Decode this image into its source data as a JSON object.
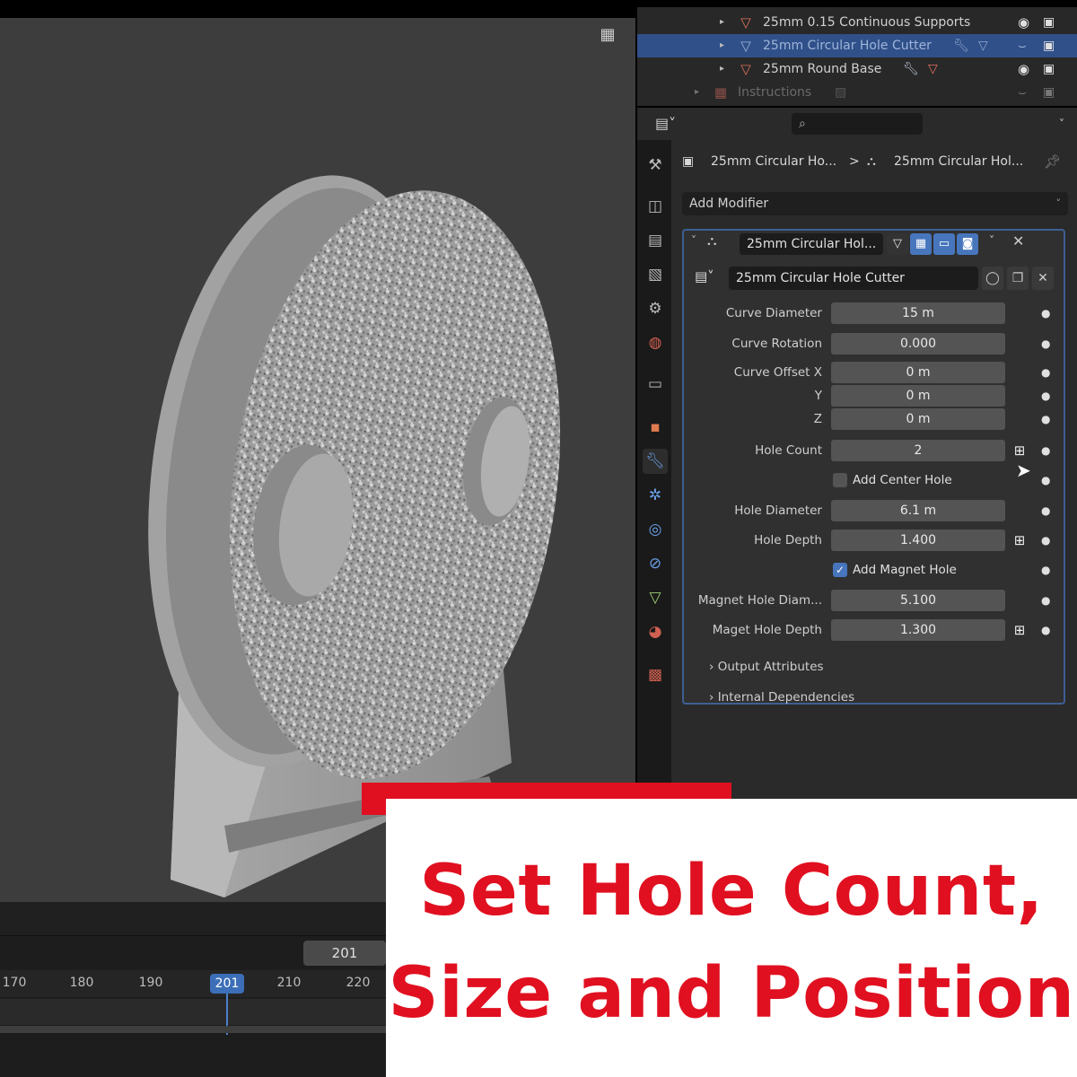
{
  "outliner": {
    "rows": [
      {
        "label": "25mm 0.15 Continuous Supports"
      },
      {
        "label": "25mm Circular Hole Cutter"
      },
      {
        "label": "25mm Round Base"
      },
      {
        "label": "Instructions"
      }
    ]
  },
  "properties": {
    "breadcrumb": {
      "object": "25mm Circular Ho...",
      "separator": ">",
      "modifier": "25mm Circular Hol..."
    },
    "add_modifier_label": "Add Modifier",
    "modifier": {
      "name": "25mm Circular Hol...",
      "node_group": "25mm Circular Hole Cutter",
      "fields": [
        {
          "label": "Curve Diameter",
          "value": "15 m"
        },
        {
          "label": "Curve Rotation",
          "value": "0.000"
        },
        {
          "label": "Curve Offset X",
          "value": "0 m"
        },
        {
          "label": "Y",
          "value": "0 m"
        },
        {
          "label": "Z",
          "value": "0 m"
        },
        {
          "label": "Hole Count",
          "value": "2"
        }
      ],
      "add_center_hole": {
        "label": "Add Center Hole",
        "checked": false
      },
      "fields2": [
        {
          "label": "Hole Diameter",
          "value": "6.1 m"
        },
        {
          "label": "Hole Depth",
          "value": "1.400"
        }
      ],
      "add_magnet_hole": {
        "label": "Add Magnet Hole",
        "checked": true
      },
      "fields3": [
        {
          "label": "Magnet Hole Diam...",
          "value": "5.100"
        },
        {
          "label": "Maget Hole Depth",
          "value": "1.300"
        }
      ],
      "subpanels": [
        "Output Attributes",
        "Internal Dependencies"
      ]
    }
  },
  "timeline": {
    "frame": "201",
    "ticks": [
      "170",
      "180",
      "190",
      "201",
      "210",
      "220"
    ]
  },
  "caption": {
    "line1": "Set Hole Count,",
    "line2": "Size and Position"
  },
  "colors": {
    "accent": "#4776bd",
    "caption_red": "#e01020"
  }
}
